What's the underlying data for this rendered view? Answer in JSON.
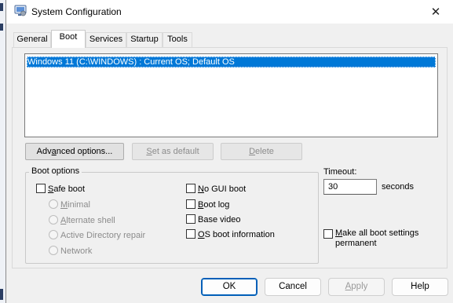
{
  "window": {
    "title": "System Configuration",
    "close_label": "✕"
  },
  "tabs": [
    {
      "label": "General"
    },
    {
      "label": "Boot"
    },
    {
      "label": "Services"
    },
    {
      "label": "Startup"
    },
    {
      "label": "Tools"
    }
  ],
  "boot_list": {
    "entries": [
      "Windows 11 (C:\\WINDOWS) : Current OS; Default OS"
    ]
  },
  "boot_buttons": {
    "advanced": {
      "pre": "Adv",
      "acc": "a",
      "post": "nced options..."
    },
    "set_default": {
      "pre": "",
      "acc": "S",
      "post": "et as default"
    },
    "delete": {
      "pre": "",
      "acc": "D",
      "post": "elete"
    }
  },
  "boot_options": {
    "title": "Boot options",
    "safe_boot": {
      "acc": "S",
      "post": "afe boot",
      "checked": false
    },
    "radios": [
      {
        "acc": "M",
        "post": "inimal"
      },
      {
        "acc": "A",
        "post": "lternate shell"
      },
      {
        "acc": "A",
        "post": "ctive Directory repair"
      },
      {
        "acc": "N",
        "post": "etwork"
      }
    ],
    "right_checks": [
      {
        "acc": "N",
        "post": "o GUI boot",
        "checked": false
      },
      {
        "acc": "B",
        "post": "oot log",
        "checked": false
      },
      {
        "acc": "B",
        "post": "ase video",
        "checked": false
      },
      {
        "acc": "O",
        "post": "S boot information",
        "checked": false
      }
    ]
  },
  "timeout": {
    "label": "Timeout:",
    "value": "30",
    "unit": "seconds"
  },
  "permanent": {
    "acc": "M",
    "post": "ake all boot settings permanent",
    "checked": false
  },
  "dialog_buttons": {
    "ok": "OK",
    "cancel": "Cancel",
    "apply": {
      "acc": "A",
      "post": "pply"
    },
    "help": "Help"
  }
}
